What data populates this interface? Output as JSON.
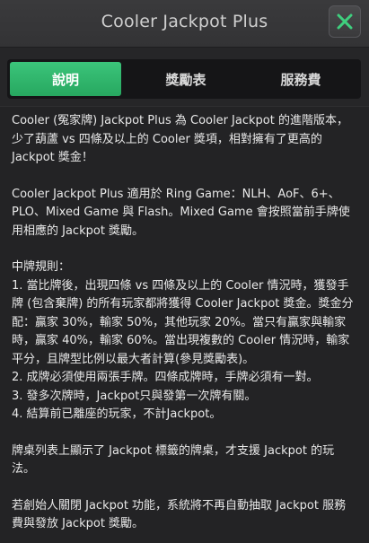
{
  "dialog": {
    "title": "Cooler Jackpot Plus",
    "close_icon": "close-x-icon",
    "accent_color": "#2fb66b"
  },
  "tabs": [
    {
      "label": "說明",
      "active": true
    },
    {
      "label": "獎勵表",
      "active": false
    },
    {
      "label": "服務費",
      "active": false
    }
  ],
  "content": {
    "intro": "Cooler (冤家牌) Jackpot Plus 為 Cooler Jackpot 的進階版本，少了葫蘆 vs 四條及以上的 Cooler 獎項，相對擁有了更高的 Jackpot 獎金！",
    "applicable": "Cooler Jackpot Plus 適用於 Ring Game：NLH、AoF、6+、PLO、Mixed Game 與 Flash。Mixed Game 會按照當前手牌使用相應的 Jackpot 獎勵。",
    "rules_title": "中牌規則：",
    "rules": [
      "1. 當比牌後，出現四條 vs 四條及以上的 Cooler 情況時，獲發手牌 (包含棄牌) 的所有玩家都將獲得 Cooler Jackpot 獎金。獎金分配：贏家 30%，輸家 50%，其他玩家 20%。當只有贏家與輸家時，贏家 40%，輸家 60%。當出現複數的 Cooler 情況時，輸家平分，且牌型比例以最大者計算(參見獎勵表)。",
      "2. 成牌必須使用兩張手牌。四條成牌時，手牌必須有一對。",
      "3. 發多次牌時，Jackpot只與發第一次牌有關。",
      "4. 結算前已離座的玩家，不計Jackpot。"
    ],
    "table_note": "牌桌列表上顯示了 Jackpot 標籤的牌桌，才支援 Jackpot 的玩法。",
    "founder_note": "若創始人關閉 Jackpot 功能，系統將不再自動抽取 Jackpot 服務費與發放 Jackpot 獎勵。"
  }
}
